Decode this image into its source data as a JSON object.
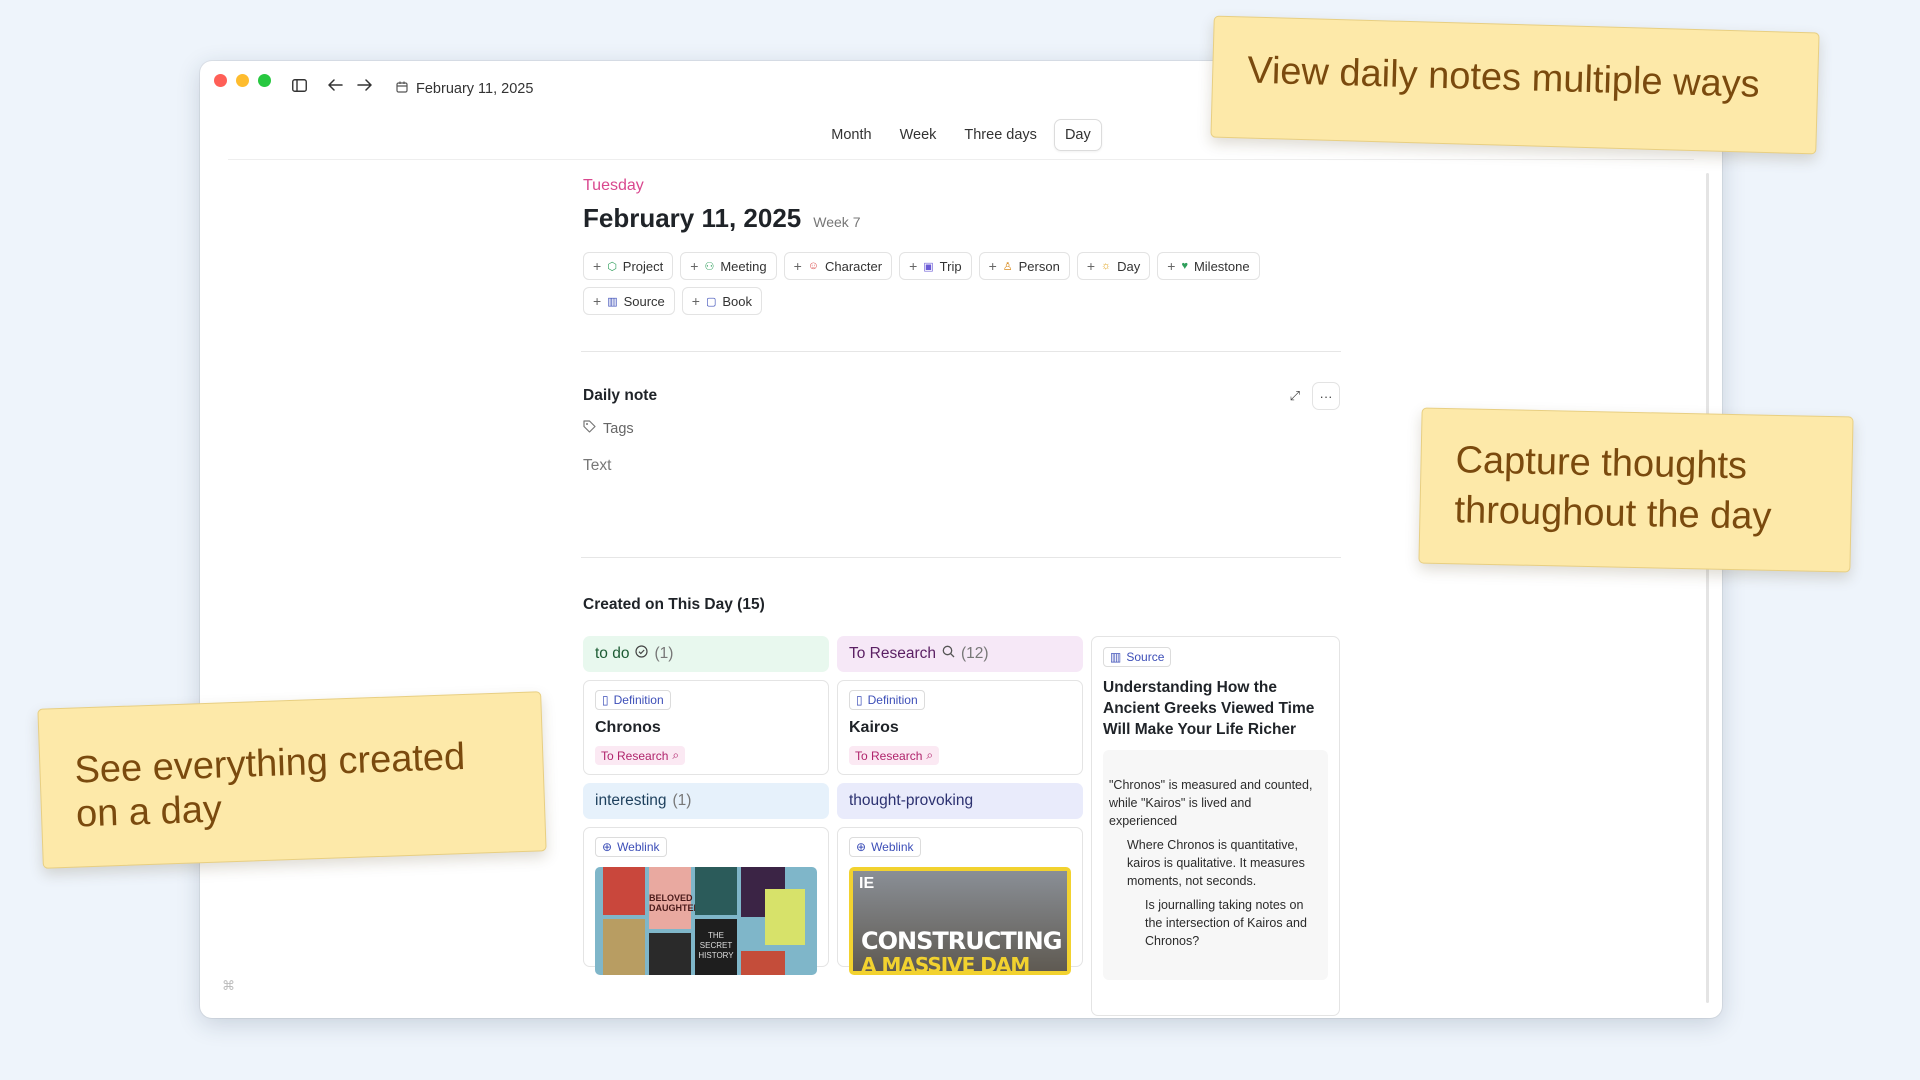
{
  "titlebar": {
    "date": "February 11, 2025",
    "traffic_colors": [
      "#ff5f57",
      "#febc2e",
      "#28c840"
    ]
  },
  "view_tabs": [
    {
      "label": "Month",
      "active": false
    },
    {
      "label": "Week",
      "active": false
    },
    {
      "label": "Three days",
      "active": false
    },
    {
      "label": "Day",
      "active": true
    }
  ],
  "day": {
    "weekday": "Tuesday",
    "date": "February 11, 2025",
    "week": "Week 7"
  },
  "templates": [
    {
      "label": "Project",
      "icon": "cube-icon",
      "color": "#2f9e5b"
    },
    {
      "label": "Meeting",
      "icon": "people-icon",
      "color": "#2f9e5b"
    },
    {
      "label": "Character",
      "icon": "character-icon",
      "color": "#d94848"
    },
    {
      "label": "Trip",
      "icon": "luggage-icon",
      "color": "#6b5bd6"
    },
    {
      "label": "Person",
      "icon": "person-icon",
      "color": "#d98b1e"
    },
    {
      "label": "Day",
      "icon": "sun-icon",
      "color": "#e0a21b"
    },
    {
      "label": "Milestone",
      "icon": "trophy-icon",
      "color": "#2f9e5b"
    },
    {
      "label": "Source",
      "icon": "library-icon",
      "color": "#3d4fb8"
    },
    {
      "label": "Book",
      "icon": "book-icon",
      "color": "#3d4fb8"
    }
  ],
  "daily_note": {
    "title": "Daily note",
    "tags_placeholder": "Tags",
    "text_placeholder": "Text"
  },
  "created": {
    "heading": "Created on This Day (15)",
    "groups": {
      "todo": {
        "label": "to do",
        "count": "(1)",
        "bg": "#e8f8ee"
      },
      "research": {
        "label": "To Research",
        "count": "(12)",
        "bg": "#f6e8f7"
      },
      "interesting": {
        "label": "interesting",
        "count": "(1)",
        "bg": "#e6f1fb"
      },
      "thought": {
        "label": "thought-provoking",
        "bg": "#e9ebfb"
      }
    },
    "cards": {
      "chronos": {
        "badge": "Definition",
        "title": "Chronos",
        "tag": "To Research"
      },
      "kairos": {
        "badge": "Definition",
        "title": "Kairos",
        "tag": "To Research"
      },
      "weblink1": {
        "badge": "Weblink"
      },
      "weblink2": {
        "badge": "Weblink",
        "thumb_text_top": "IE",
        "thumb_text_1": "CONSTRUCTING",
        "thumb_text_2": "A MASSIVE DAM"
      }
    },
    "source": {
      "badge": "Source",
      "title": "Understanding How the Ancient Greeks Viewed Time Will Make Your Life Richer",
      "para1": "\"Chronos\" is measured and counted, while \"Kairos\" is lived and experienced",
      "para2": "Where Chronos is quantitative, kairos is qualitative. It measures moments, not seconds.",
      "para3": "Is journalling taking notes on the intersection of Kairos and Chronos?"
    }
  },
  "book_covers": {
    "beloved": "BELOVED",
    "daughter": "DAUGHTER",
    "secret": "THE SECRET HISTORY"
  },
  "callouts": {
    "top": "View daily notes multiple ways",
    "right_line1": "Capture thoughts",
    "right_line2": "throughout the day",
    "left_line1": "See everything created",
    "left_line2": "on a day"
  },
  "shortcut_glyph": "⌘"
}
